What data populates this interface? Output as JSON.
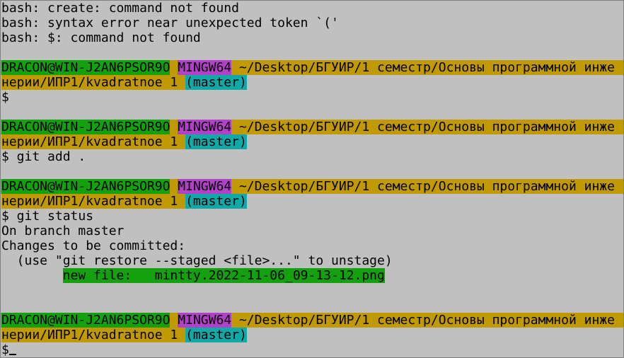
{
  "colors": {
    "background": "#c0c0c0",
    "user_host": "#13a10e",
    "system": "#b340c8",
    "path": "#c09a00",
    "branch": "#11a8a8",
    "staged_file": "#13a10e"
  },
  "output_top": [
    "bash: create: command not found",
    "bash: syntax error near unexpected token `('",
    "bash: $: command not found"
  ],
  "prompt": {
    "user_host": "DRACON@WIN-J2AN6PSOR9O",
    "system": "MINGW64",
    "path_line1": "~/Desktop/БГУИР/1 семестр/Основы программной инже",
    "path_line2": "нерии/ИПР1/kvadratnoe 1",
    "branch": "(master)"
  },
  "commands": {
    "c1": "$",
    "c2": "$ git add .",
    "c3": "$ git status",
    "c4": "$"
  },
  "status_output": {
    "line1": "On branch master",
    "line2": "Changes to be committed:",
    "line3": "  (use \"git restore --staged <file>...\" to unstage)",
    "new_file_label": "new file:   ",
    "new_file_name": "mintty.2022-11-06_09-13-12.png"
  }
}
